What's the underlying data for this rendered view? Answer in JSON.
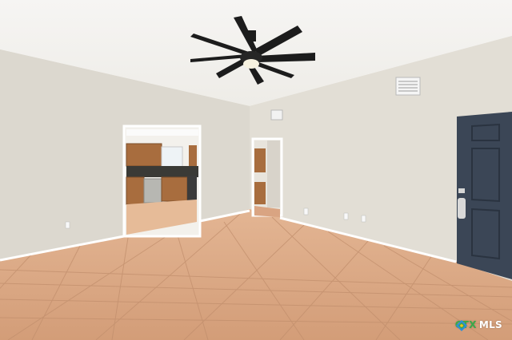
{
  "scene": {
    "subject": "empty-living-room",
    "features": [
      "ceiling-fan",
      "hvac-vent",
      "kitchen-doorway",
      "hallway-doorway",
      "front-door",
      "tile-floor"
    ],
    "colors": {
      "wall": "#ddd8cf",
      "ceiling": "#f2f1ee",
      "floor_tile": "#d8a886",
      "grout": "#c79676",
      "door": "#3b4656",
      "fan": "#1c1c1c",
      "cabinet": "#a86d3e",
      "baseboard": "#ffffff"
    }
  },
  "watermark": {
    "brand": "CTX",
    "suffix": "MLS",
    "colors": [
      "#3aa84a",
      "#2b8fd8",
      "#f4c020"
    ]
  }
}
